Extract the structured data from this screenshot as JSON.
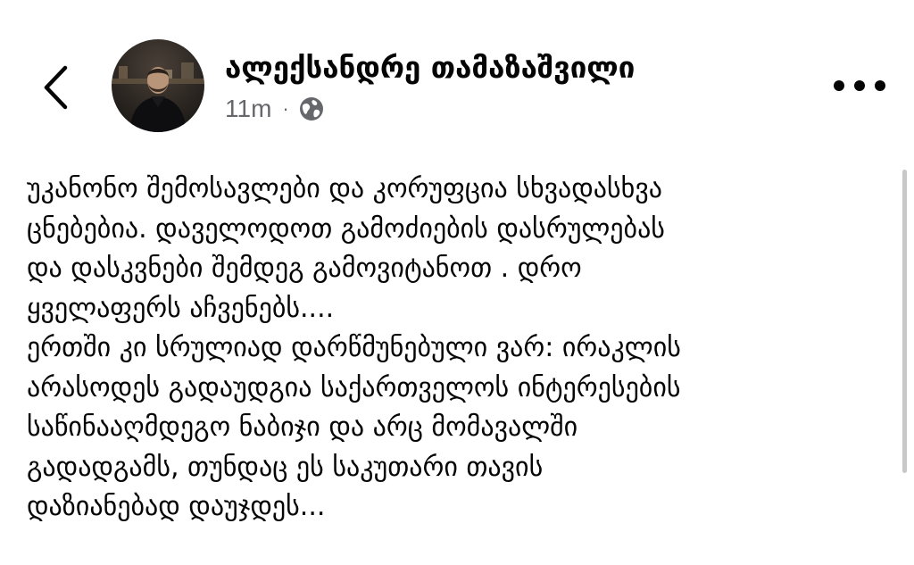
{
  "post": {
    "author_name": "ალექსანდრე თამაზაშვილი",
    "time": "11m",
    "separator": "·",
    "audience_icon": "globe-icon",
    "lines": [
      "უკანონო შემოსავლები და კორუფცია სხვადასხვა",
      "ცნებებია. დაველოდოთ გამოძიების დასრულებას",
      "და დასკვნები შემდეგ გამოვიტანოთ . დრო",
      "ყველაფერს აჩვენებს....",
      "ერთში კი სრულიად დარწმუნებული ვარ: ირაკლის",
      "არასოდეს გადაუდგია საქართველოს ინტერესების",
      "საწინააღმდეგო  ნაბიჯი და არც მომავალში",
      "გადადგამს, თუნდაც ეს საკუთარი თავის",
      "დაზიანებად დაუჯდეს..."
    ]
  },
  "icons": {
    "back": "chevron-left-icon",
    "more": "more-options-icon"
  },
  "colors": {
    "text": "#050505",
    "secondary_text": "#65676b",
    "background": "#ffffff"
  }
}
